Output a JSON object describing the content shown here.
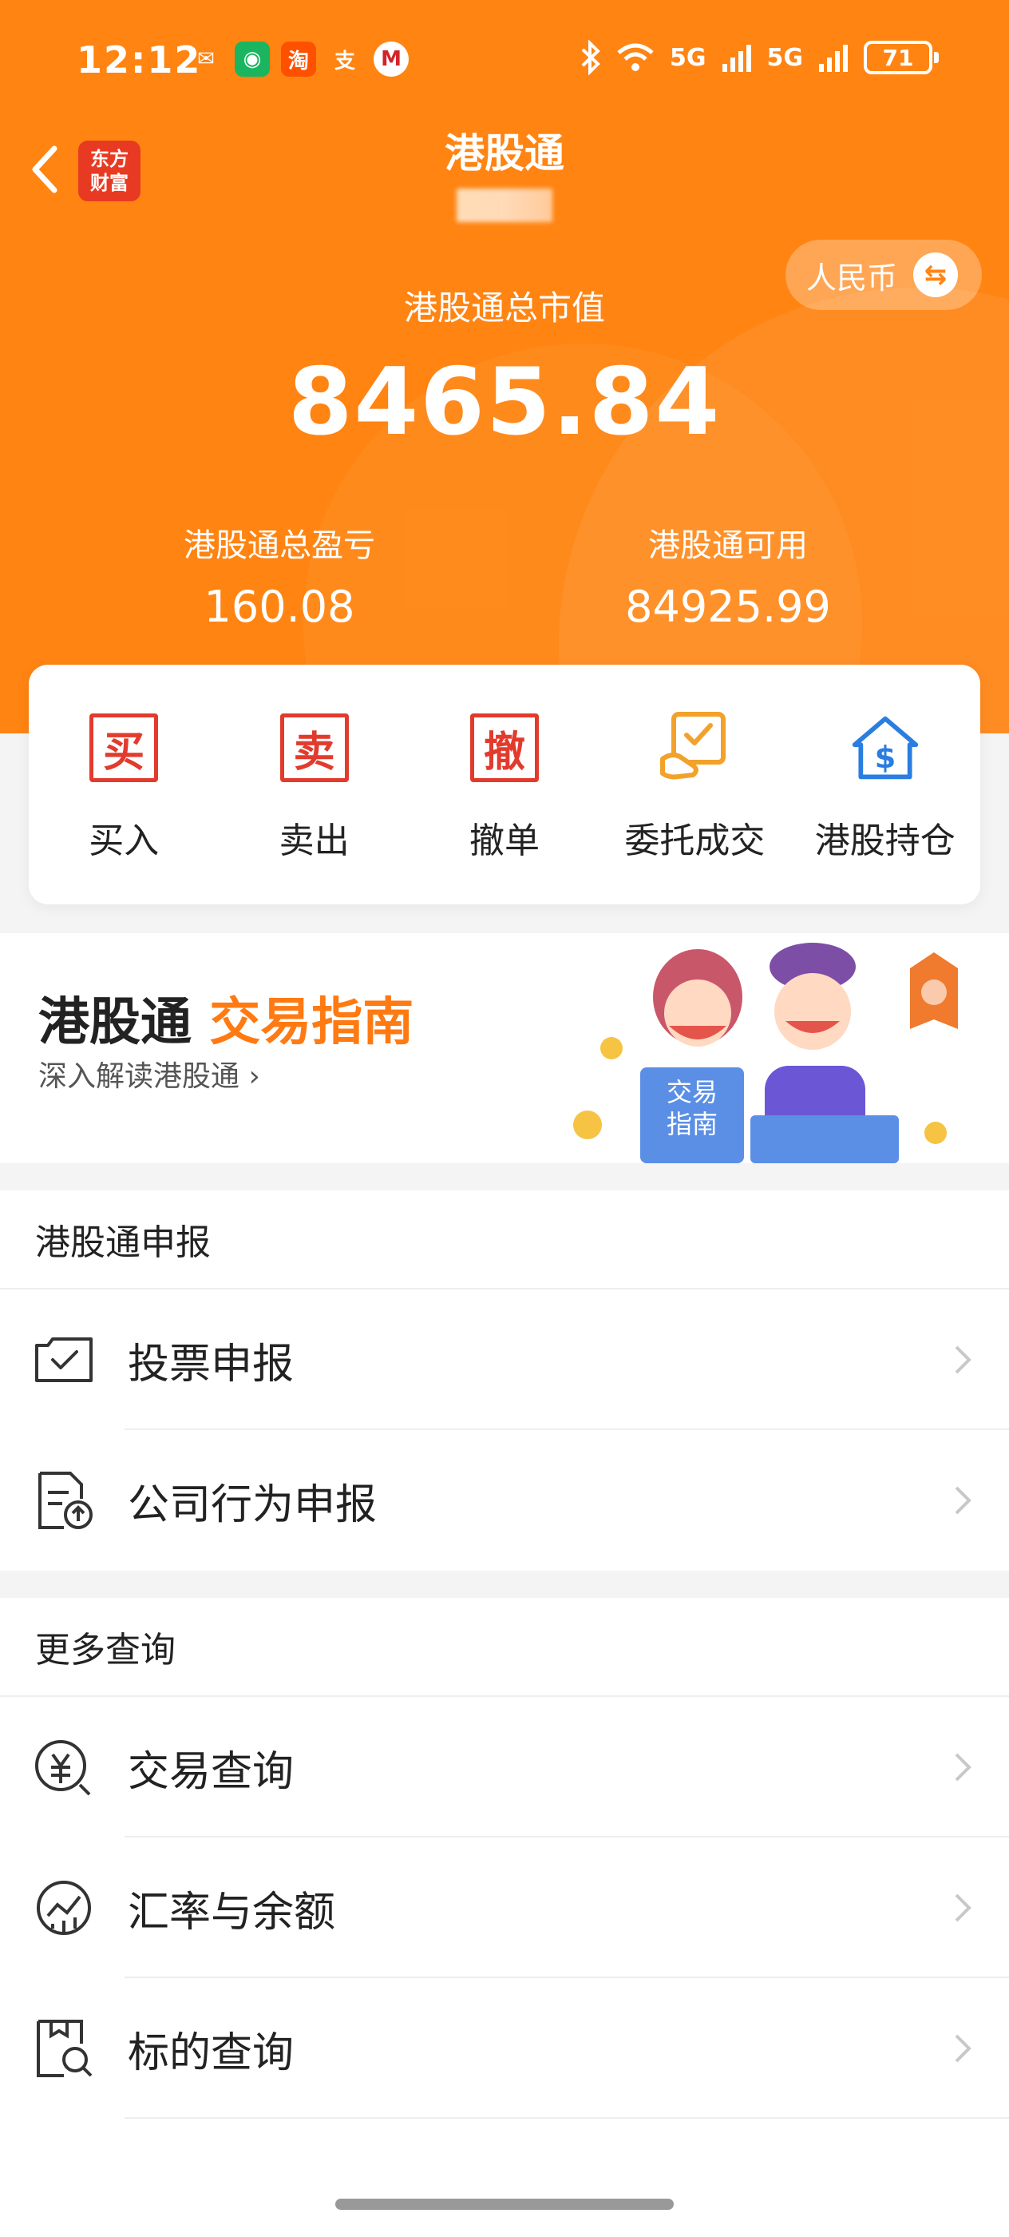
{
  "status_bar": {
    "time": "12:12",
    "battery": "71",
    "network": "5G",
    "apps": [
      "wechat-icon",
      "shield-app-icon",
      "taobao-icon",
      "alipay-icon",
      "bank-icon"
    ],
    "app_glyphs": [
      "✉",
      "◉",
      "淘",
      "支",
      "M"
    ]
  },
  "header": {
    "title": "港股通",
    "logo_line1": "东方",
    "logo_line2": "财富",
    "currency": "人民币",
    "currency_switch_glyph": "⇆"
  },
  "summary": {
    "market_value_label": "港股通总市值",
    "market_value": "8465.84",
    "pnl_label": "港股通总盈亏",
    "pnl": "160.08",
    "available_label": "港股通可用",
    "available": "84925.99"
  },
  "actions": [
    {
      "label": "买入",
      "glyph": "买"
    },
    {
      "label": "卖出",
      "glyph": "卖"
    },
    {
      "label": "撤单",
      "glyph": "撤"
    },
    {
      "label": "委托成交"
    },
    {
      "label": "港股持仓",
      "glyph": "$"
    }
  ],
  "banner": {
    "title_part1": "港股通",
    "title_part2": "交易指南",
    "subtitle": "深入解读港股通",
    "subtitle_arrow": "›",
    "sign_text_line1": "交易",
    "sign_text_line2": "指南"
  },
  "sections": {
    "declaration": {
      "title": "港股通申报",
      "items": [
        {
          "label": "投票申报"
        },
        {
          "label": "公司行为申报"
        }
      ]
    },
    "more_queries": {
      "title": "更多查询",
      "items": [
        {
          "label": "交易查询"
        },
        {
          "label": "汇率与余额"
        },
        {
          "label": "标的查询"
        }
      ]
    }
  },
  "colors": {
    "brand_orange": "#ff8412",
    "action_red": "#e23b2d",
    "action_gold": "#f2a12a",
    "action_blue": "#2a7de1"
  }
}
